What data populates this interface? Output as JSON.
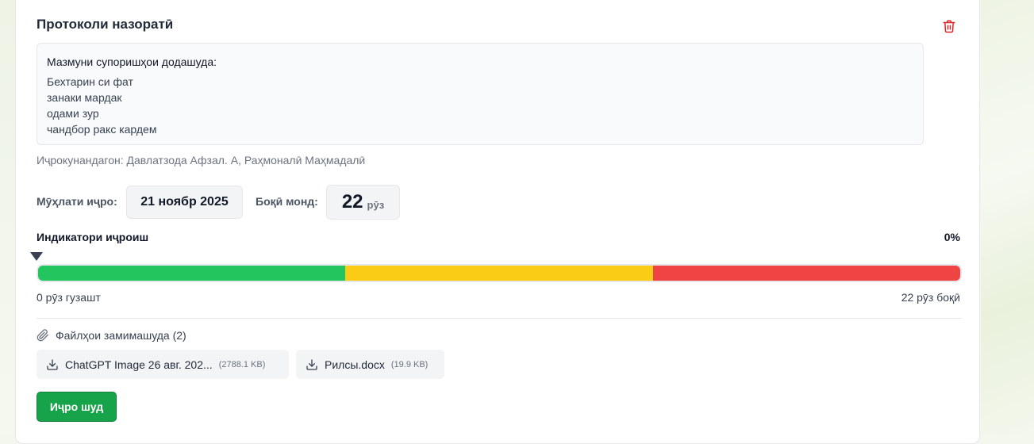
{
  "card": {
    "title": "Протоколи назоратӣ",
    "content_label": "Мазмуни супоришҳои додашуда:",
    "content_lines": [
      "Бехтарин си фат",
      "занаки мардак",
      "одами зур",
      "чандбор ракс кардем"
    ],
    "executors": "Иҷрокунандагон: Давлатзода Афзал. А, Раҳмоналӣ Маҳмадалӣ"
  },
  "deadline": {
    "label": "Мӯҳлати иҷро:",
    "value": "21 ноябр 2025"
  },
  "remaining": {
    "label": "Боқӣ монд:",
    "value": "22",
    "unit": "рӯз"
  },
  "indicator": {
    "label": "Индикатори иҷроиш",
    "percent_text": "0%",
    "progress_fraction": 0,
    "segments": [
      {
        "color": "#22c55e",
        "fraction": 0.3333
      },
      {
        "color": "#facc15",
        "fraction": 0.3333
      },
      {
        "color": "#ef4444",
        "fraction": 0.3334
      }
    ],
    "passed_text": "0 рӯз гузашт",
    "left_text": "22 рӯз боқӣ"
  },
  "files": {
    "heading": "Файлҳои замимашуда (2)",
    "items": [
      {
        "name": "ChatGPT Image 26 авг. 202...",
        "size": "(2788.1 KB)"
      },
      {
        "name": "Рилсы.docx",
        "size": "(19.9 KB)"
      }
    ]
  },
  "actions": {
    "done_label": "Иҷро шуд"
  },
  "colors": {
    "accent": "#16a34a",
    "danger": "#dc2626"
  },
  "icons": {
    "delete": "trash-icon",
    "attachment": "paperclip-icon",
    "download": "download-icon"
  }
}
